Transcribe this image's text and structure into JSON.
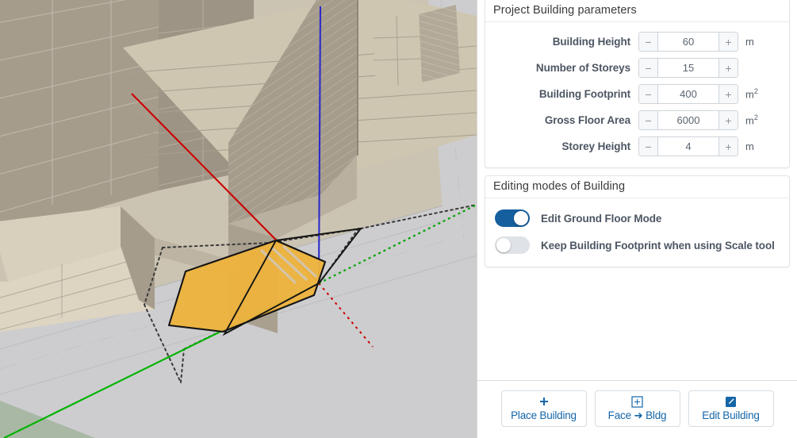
{
  "viewport": {
    "name": "3d-model-viewport",
    "description": "SketchUp-style 3D city model with selected yellow building footprint",
    "colors": {
      "ground": "#cfc9b8",
      "road": "#cdcdcf",
      "building_light": "#d6cdb8",
      "building_shaded": "#a39a8a",
      "footprint_fill": "#edb33d",
      "footprint_stroke": "#1a1a1a",
      "axis_red": "#d40000",
      "axis_green": "#00bb00",
      "axis_blue": "#2222cc",
      "grass": "#a8b8a4"
    }
  },
  "panel": {
    "parameters_card": {
      "header": "Project Building parameters",
      "rows": [
        {
          "label": "Building Height",
          "value": "60",
          "unit": "m",
          "unit_sup": "",
          "minus": "−",
          "plus": "+"
        },
        {
          "label": "Number of Storeys",
          "value": "15",
          "unit": "",
          "unit_sup": "",
          "minus": "−",
          "plus": "+"
        },
        {
          "label": "Building Footprint",
          "value": "400",
          "unit": "m",
          "unit_sup": "2",
          "minus": "−",
          "plus": "+"
        },
        {
          "label": "Gross Floor Area",
          "value": "6000",
          "unit": "m",
          "unit_sup": "2",
          "minus": "−",
          "plus": "+"
        },
        {
          "label": "Storey Height",
          "value": "4",
          "unit": "m",
          "unit_sup": "",
          "minus": "−",
          "plus": "+"
        }
      ]
    },
    "editing_card": {
      "header": "Editing modes of Building",
      "toggles": [
        {
          "label": "Edit Ground Floor Mode",
          "state": "on"
        },
        {
          "label": "Keep Building Footprint when using Scale tool",
          "state": "off"
        }
      ]
    },
    "footer": {
      "buttons": [
        {
          "label": "Place Building",
          "icon": "plus-icon"
        },
        {
          "label": "Face ➜ Bldg",
          "icon": "square-plus-icon"
        },
        {
          "label": "Edit Building",
          "icon": "pencil-square-icon"
        }
      ]
    }
  }
}
